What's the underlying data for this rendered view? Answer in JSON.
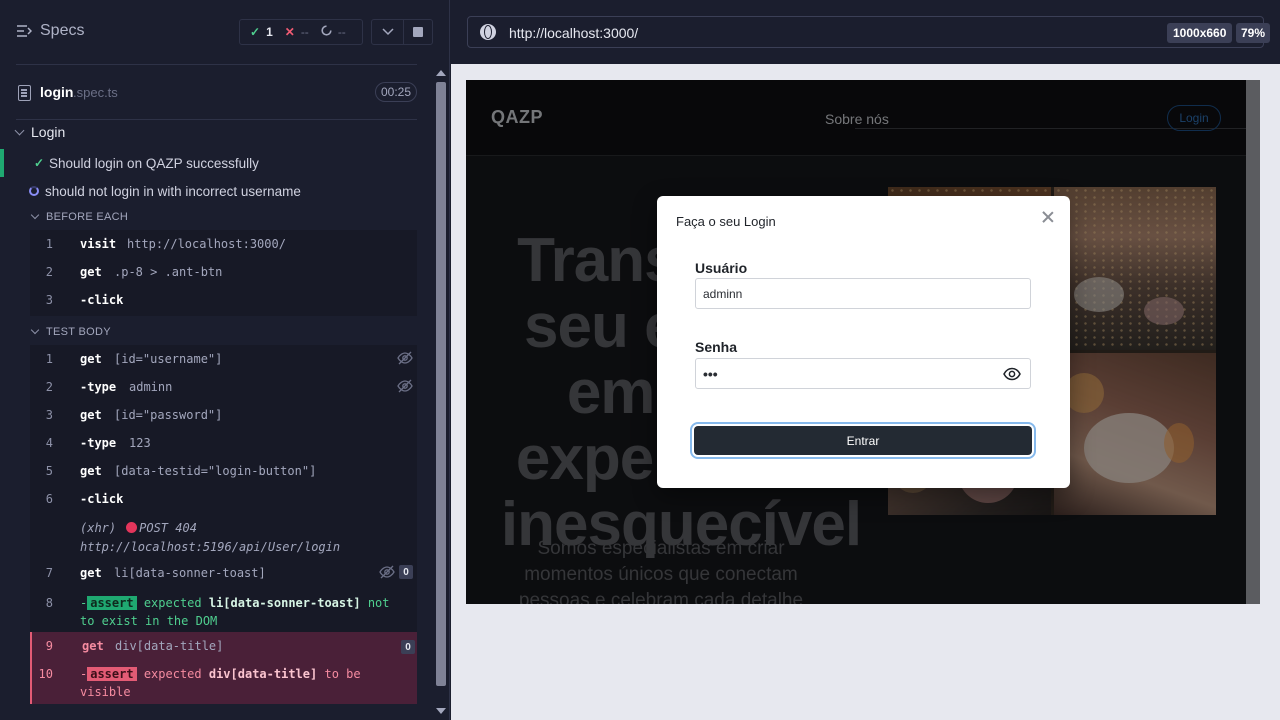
{
  "reporter": {
    "specs_label": "Specs",
    "stats": {
      "passed_icon": "✓",
      "passed": "1",
      "failed_icon": "✕",
      "failed": "--",
      "pending_icon": "spinner-icon",
      "pending": "--"
    },
    "file": {
      "name": "login",
      "ext": ".spec.ts",
      "duration": "00:25"
    },
    "suite_title": "Login",
    "tests": [
      {
        "title": "Should login on QAZP successfully",
        "state": "passed"
      },
      {
        "title": "should not login in with incorrect username",
        "state": "running"
      }
    ],
    "before_each": {
      "title": "BEFORE EACH",
      "commands": [
        {
          "n": "1",
          "name": "visit",
          "msg": "http://localhost:3000/"
        },
        {
          "n": "2",
          "name": "get",
          "msg": ".p-8 > .ant-btn"
        },
        {
          "n": "3",
          "name": "-click",
          "msg": ""
        }
      ]
    },
    "test_body": {
      "title": "TEST BODY",
      "commands": [
        {
          "n": "1",
          "name": "get",
          "msg": "[id=\"username\"]"
        },
        {
          "n": "2",
          "name": "-type",
          "msg": "adminn"
        },
        {
          "n": "3",
          "name": "get",
          "msg": "[id=\"password\"]"
        },
        {
          "n": "4",
          "name": "-type",
          "msg": "123"
        },
        {
          "n": "5",
          "name": "get",
          "msg": "[data-testid=\"login-button\"]"
        },
        {
          "n": "6",
          "name": "-click",
          "msg": ""
        },
        {
          "n": "7",
          "name": "get",
          "msg": "li[data-sonner-toast]",
          "count": "0"
        },
        {
          "n": "9",
          "name": "get",
          "msg": "div[data-title]",
          "count": "0"
        }
      ],
      "xhr": {
        "label": "(xhr)",
        "method": "POST 404",
        "url": "http://localhost:5196/api/User/login"
      },
      "assert_ok": {
        "n": "8",
        "prefix": "-",
        "tag": "assert",
        "expected": "expected",
        "subject": "li[data-sonner-toast]",
        "rest1": "not",
        "rest2": "to exist in the DOM"
      },
      "assert_fail": {
        "n": "10",
        "prefix": "-",
        "tag": "assert",
        "expected": "expected",
        "subject": "div[data-title]",
        "rest1": "to be",
        "rest2": "visible"
      }
    }
  },
  "browser": {
    "url": "http://localhost:3000/",
    "viewport": "1000x660",
    "zoom": "79%"
  },
  "site": {
    "logo": "QAZP",
    "nav_link": "Sobre nós",
    "login_button": "Login",
    "hero_title": "Transforme seu evento em uma experiência inesquecível",
    "hero_subtitle": "Somos especialistas em criar momentos únicos que conectam pessoas e celebram cada detalhe"
  },
  "modal": {
    "title": "Faça o seu Login",
    "username_label": "Usuário",
    "username_value": "adminn",
    "password_label": "Senha",
    "password_value": "•••",
    "submit_label": "Entrar"
  },
  "colors": {
    "reporter_bg": "#1b1e2e",
    "passed": "#1fa971",
    "failed": "#e35b75",
    "running": "#8a8ef7",
    "submit_bg": "#232a33",
    "focus_ring": "#86b9ec"
  }
}
